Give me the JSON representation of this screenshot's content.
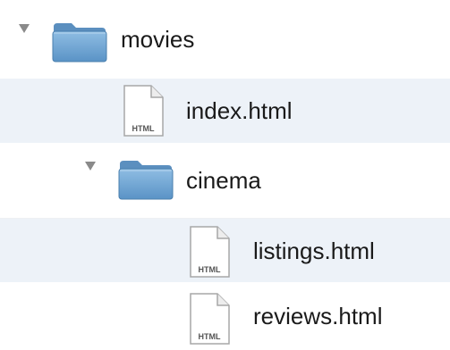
{
  "tree": {
    "rows": [
      {
        "name": "movies",
        "kind": "folder",
        "expanded": true
      },
      {
        "name": "index.html",
        "kind": "file",
        "badge": "HTML"
      },
      {
        "name": "cinema",
        "kind": "folder",
        "expanded": true
      },
      {
        "name": "listings.html",
        "kind": "file",
        "badge": "HTML"
      },
      {
        "name": "reviews.html",
        "kind": "file",
        "badge": "HTML"
      }
    ]
  },
  "colors": {
    "stripe": "#edf2f8",
    "folder": "#6ea5d3",
    "text": "#1a1a1a",
    "disclosure": "#8a8a8a"
  },
  "icons": {
    "folder": "folder-icon",
    "file": "html-file-icon",
    "disclosure": "disclosure-triangle-icon"
  }
}
